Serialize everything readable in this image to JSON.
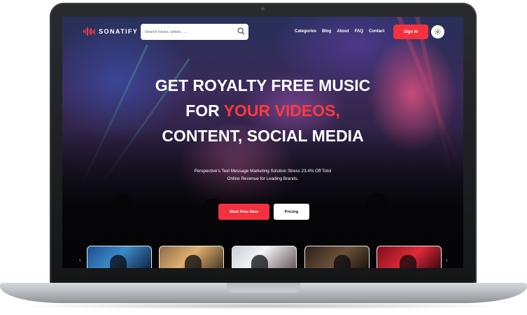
{
  "brand": {
    "name": "SONATIFY",
    "accent_color": "#f2323f"
  },
  "search": {
    "placeholder": "Search tracks, artists, ....",
    "icon": "search-icon"
  },
  "nav": {
    "items": [
      "Categories",
      "Blog",
      "About",
      "FAQ",
      "Contact"
    ]
  },
  "header": {
    "signin_label": "Sign In",
    "theme_icon": "sun-icon"
  },
  "hero": {
    "title_line1": "GET ROYALTY FREE MUSIC",
    "title_line2_prefix": "FOR ",
    "title_line2_accent": "YOUR VIDEOS,",
    "title_line3": "CONTENT, SOCIAL MEDIA",
    "subtitle_line1": "Perspective's Text Message Marketing Solution Stress 23.4% Off Totol",
    "subtitle_line2": "Online Revenue for Leading Brands.",
    "primary_button": "Start Free Now",
    "secondary_button": "Pricing"
  },
  "carousel": {
    "prev_icon": "chevron-left-icon",
    "next_icon": "chevron-right-icon",
    "thumbnails": [
      "thumbnail-1",
      "thumbnail-2",
      "thumbnail-3",
      "thumbnail-4",
      "thumbnail-5"
    ]
  }
}
